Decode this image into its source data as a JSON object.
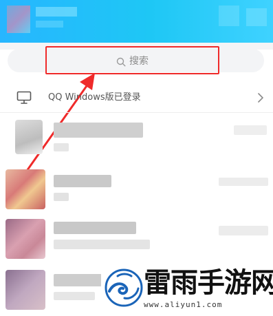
{
  "search": {
    "label": "搜索",
    "icon": "search-icon"
  },
  "device_status": {
    "text": "QQ Windows版已登录",
    "icon": "monitor-icon",
    "trailing_icon": "chevron-right-icon"
  },
  "colors": {
    "header": "#1ec7f5",
    "annotation": "#ef2a2a",
    "watermark_blue": "#1a64b8"
  },
  "watermark": {
    "title": "雷雨手游网",
    "url": "www.aliyun1.com"
  }
}
